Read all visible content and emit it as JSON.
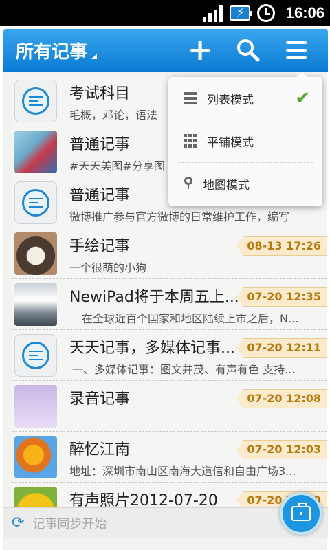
{
  "status_bar": {
    "time": "16:06"
  },
  "app_bar": {
    "title": "所有记事"
  },
  "notes": [
    {
      "title": "考试科目",
      "subtitle": "毛概，邓论，语法",
      "date": "",
      "thumb": "document-icon"
    },
    {
      "title": "普通记事",
      "subtitle": "#天天美图#分享图",
      "date": "",
      "thumb": "photo-kids"
    },
    {
      "title": "普通记事",
      "subtitle": "微博推广参与官方微博的日常维护工作，编写",
      "date": "",
      "thumb": "document-icon"
    },
    {
      "title": "手绘记事",
      "subtitle": "一个很萌的小狗",
      "date": "08-13 17:26",
      "thumb": "photo-dog"
    },
    {
      "title": "NewiPad将于本周五上...",
      "subtitle": "在全球近百个国家和地区陆续上市之后，N...",
      "date": "07-20 12:35",
      "thumb": "photo-street"
    },
    {
      "title": "天天记事，多媒体记事...",
      "subtitle": "一、多媒体记事：图文并茂、有声有色 支持...",
      "date": "07-20 12:11",
      "thumb": "document-icon"
    },
    {
      "title": "录音记事",
      "subtitle": "",
      "date": "07-20 12:08",
      "thumb": "photo-kitty"
    },
    {
      "title": "醉忆江南",
      "subtitle": "地址：深圳市南山区南海大道信和自由广场3...",
      "date": "07-20 12:03",
      "thumb": "photo-flower"
    },
    {
      "title": "有声照片2012-07-20",
      "subtitle": "",
      "date": "07-20 11:59",
      "thumb": "photo-sunflower"
    }
  ],
  "dropdown": {
    "items": [
      {
        "label": "列表模式",
        "icon": "list-icon",
        "selected": true
      },
      {
        "label": "平铺模式",
        "icon": "grid-icon",
        "selected": false
      },
      {
        "label": "地图模式",
        "icon": "map-pin-icon",
        "selected": false
      }
    ]
  },
  "bottom_bar": {
    "sync_text": "记事同步开始"
  },
  "colors": {
    "accent": "#0a7bd3",
    "date_tag_text": "#b47a10",
    "check": "#4caf2a"
  }
}
